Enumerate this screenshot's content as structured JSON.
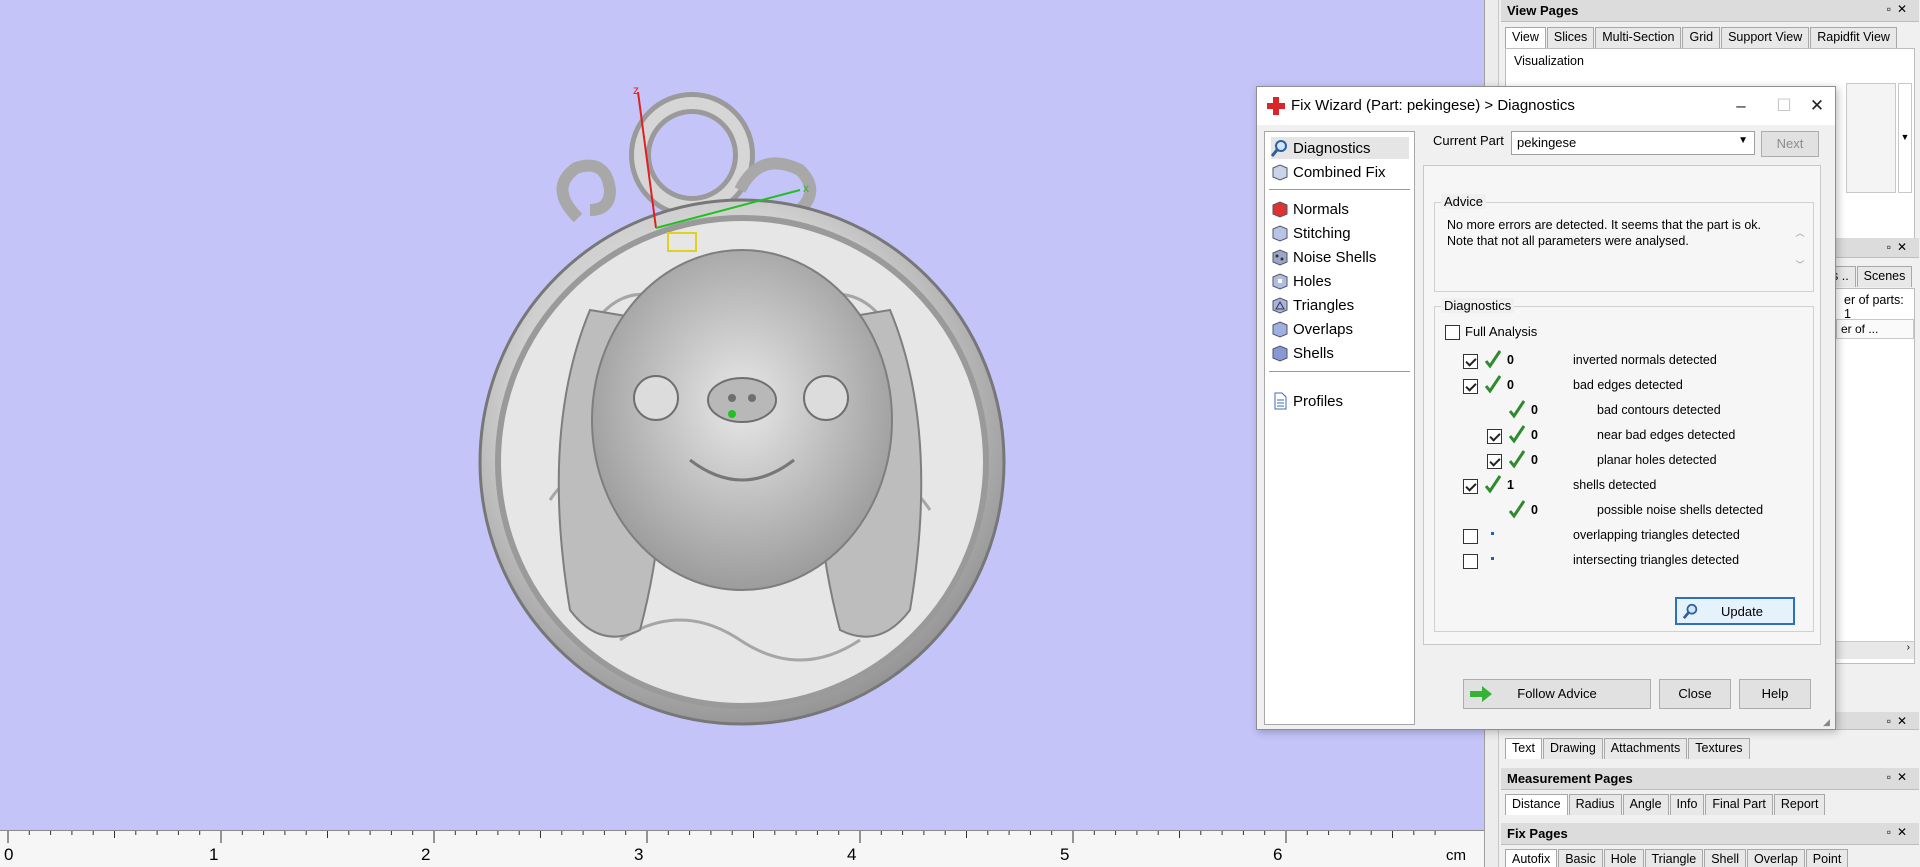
{
  "viewport": {
    "ruler": {
      "labels": [
        "0",
        "1",
        "2",
        "3",
        "4",
        "5",
        "6"
      ],
      "unit": "cm"
    },
    "axes": {
      "z_label": "z",
      "x_label": "x"
    }
  },
  "dock": {
    "view_pages": {
      "title": "View Pages",
      "tabs": [
        "View",
        "Slices",
        "Multi-Section",
        "Grid",
        "Support View",
        "Rapidfit View"
      ],
      "active_tab": "View",
      "group_label": "Visualization"
    },
    "parts_pane": {
      "tabs_partial": [
        "s ..",
        "Scenes"
      ],
      "number_of_parts": "er of parts: 1",
      "column_header": "er of ..."
    },
    "text_pages": {
      "tabs": [
        "Text",
        "Drawing",
        "Attachments",
        "Textures"
      ],
      "active_tab": "Text"
    },
    "measurement_pages": {
      "title": "Measurement Pages",
      "tabs": [
        "Distance",
        "Radius",
        "Angle",
        "Info",
        "Final Part",
        "Report"
      ],
      "active_tab": "Distance"
    },
    "fix_pages": {
      "title": "Fix Pages",
      "tabs": [
        "Autofix",
        "Basic",
        "Hole",
        "Triangle",
        "Shell",
        "Overlap",
        "Point"
      ],
      "active_tab": "Autofix"
    }
  },
  "dialog": {
    "title": "Fix Wizard (Part: pekingese) > Diagnostics",
    "nav": {
      "top_items": [
        {
          "label": "Diagnostics",
          "icon": "magnifier-icon",
          "selected": true
        },
        {
          "label": "Combined Fix",
          "icon": "cube-icon",
          "selected": false
        }
      ],
      "mid_items": [
        {
          "label": "Normals",
          "icon": "normals-cube-icon"
        },
        {
          "label": "Stitching",
          "icon": "stitching-cube-icon"
        },
        {
          "label": "Noise Shells",
          "icon": "noise-shells-icon"
        },
        {
          "label": "Holes",
          "icon": "holes-cube-icon"
        },
        {
          "label": "Triangles",
          "icon": "triangles-cube-icon"
        },
        {
          "label": "Overlaps",
          "icon": "overlaps-cube-icon"
        },
        {
          "label": "Shells",
          "icon": "shells-cube-icon"
        }
      ],
      "bottom_items": [
        {
          "label": "Profiles",
          "icon": "document-icon"
        }
      ]
    },
    "current_part_label": "Current Part",
    "current_part_value": "pekingese",
    "next_label": "Next",
    "advice_legend": "Advice",
    "advice_text": "No more errors are detected. It seems that the part is ok. Note that not all parameters were analysed.",
    "diagnostics_legend": "Diagnostics",
    "full_analysis_label": "Full Analysis",
    "rows": [
      {
        "checkbox": true,
        "checked": true,
        "status": "ok",
        "count": "0",
        "text": "inverted normals detected",
        "indent": false
      },
      {
        "checkbox": true,
        "checked": true,
        "status": "ok",
        "count": "0",
        "text": "bad edges detected",
        "indent": false
      },
      {
        "checkbox": false,
        "checked": false,
        "status": "ok",
        "count": "0",
        "text": "bad contours detected",
        "indent": true
      },
      {
        "checkbox": true,
        "checked": true,
        "status": "ok",
        "count": "0",
        "text": "near bad edges detected",
        "indent": true
      },
      {
        "checkbox": true,
        "checked": true,
        "status": "ok",
        "count": "0",
        "text": "planar holes detected",
        "indent": true
      },
      {
        "checkbox": true,
        "checked": true,
        "status": "ok",
        "count": "1",
        "text": "shells detected",
        "indent": false
      },
      {
        "checkbox": false,
        "checked": false,
        "status": "ok",
        "count": "0",
        "text": "possible noise shells detected",
        "indent": true
      },
      {
        "checkbox": true,
        "checked": false,
        "status": "none",
        "count": "",
        "text": "overlapping triangles detected",
        "indent": false
      },
      {
        "checkbox": true,
        "checked": false,
        "status": "none",
        "count": "",
        "text": "intersecting triangles detected",
        "indent": false
      }
    ],
    "update_label": "Update",
    "follow_advice_label": "Follow Advice",
    "close_label": "Close",
    "help_label": "Help"
  },
  "colors": {
    "viewport_bg": "#c4c4f9",
    "check_green": "#2e8b2e",
    "accent_blue": "#1f5fbf"
  }
}
